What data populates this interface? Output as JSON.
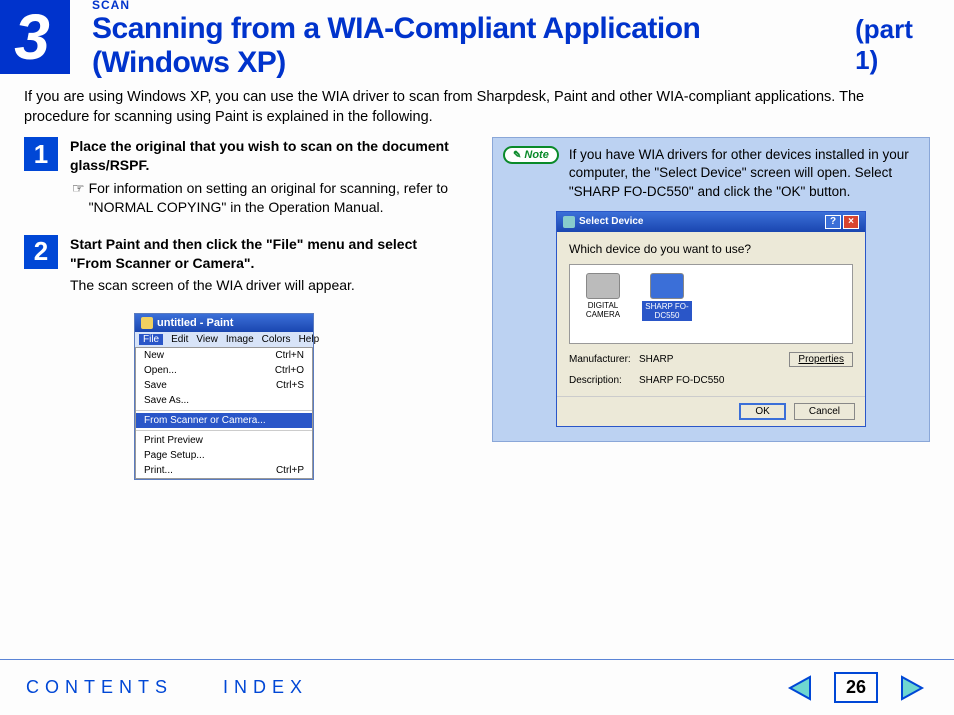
{
  "header": {
    "chapter_num": "3",
    "section_label": "SCAN",
    "title": "Scanning from a WIA-Compliant Application (Windows XP)",
    "part": "(part 1)"
  },
  "intro": "If you are using Windows XP, you can use the WIA driver to scan from Sharpdesk, Paint and other WIA-compliant applications. The procedure for scanning using Paint is explained in the following.",
  "steps": [
    {
      "num": "1",
      "heading": "Place the original that you wish to scan on the document glass/RSPF.",
      "sub": "For information on setting an original for scanning, refer to \"NORMAL COPYING\" in the Operation Manual."
    },
    {
      "num": "2",
      "heading": "Start Paint and then click the \"File\" menu and select \"From Scanner or Camera\".",
      "body": "The scan screen of the WIA driver will appear."
    }
  ],
  "paint": {
    "title": "untitled - Paint",
    "menus": [
      "File",
      "Edit",
      "View",
      "Image",
      "Colors",
      "Help"
    ],
    "items": [
      {
        "label": "New",
        "accel": "Ctrl+N"
      },
      {
        "label": "Open...",
        "accel": "Ctrl+O"
      },
      {
        "label": "Save",
        "accel": "Ctrl+S"
      },
      {
        "label": "Save As...",
        "accel": ""
      },
      {
        "sep": true
      },
      {
        "label": "From Scanner or Camera...",
        "accel": "",
        "selected": true
      },
      {
        "sep": true
      },
      {
        "label": "Print Preview",
        "accel": ""
      },
      {
        "label": "Page Setup...",
        "accel": ""
      },
      {
        "label": "Print...",
        "accel": "Ctrl+P"
      }
    ]
  },
  "note": {
    "badge": "Note",
    "text": "If you have WIA drivers for other devices installed in your computer, the \"Select Device\" screen will open. Select \"SHARP FO-DC550\" and click the \"OK\" button."
  },
  "dialog": {
    "title": "Select Device",
    "question": "Which device do you want to use?",
    "devices": [
      {
        "name": "DIGITAL CAMERA",
        "selected": false
      },
      {
        "name": "SHARP FO-DC550",
        "selected": true
      }
    ],
    "manufacturer_label": "Manufacturer:",
    "manufacturer": "SHARP",
    "description_label": "Description:",
    "description": "SHARP FO-DC550",
    "properties": "Properties",
    "ok": "OK",
    "cancel": "Cancel"
  },
  "footer": {
    "contents": "CONTENTS",
    "index": "INDEX",
    "page": "26"
  }
}
